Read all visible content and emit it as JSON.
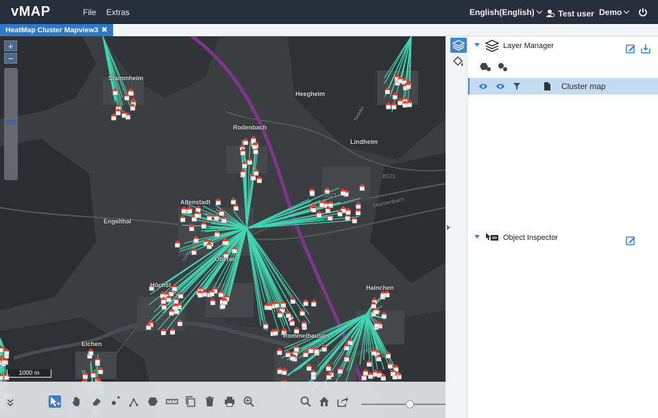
{
  "app": {
    "brand": "vMAP",
    "menu": [
      {
        "label": "File"
      },
      {
        "label": "Extras"
      }
    ],
    "language": "English(English)",
    "user": "Test user",
    "workspace": "Demo"
  },
  "tab": {
    "title": "HeatMap Cluster Mapview3",
    "close_glyph": "✖"
  },
  "map": {
    "zoom_in": "+",
    "zoom_out": "−",
    "scale": "1000 m",
    "places": [
      "Stammheim",
      "Heegheim",
      "Rodenbach",
      "Lindheim",
      "Altenstadt",
      "Engelthal",
      "Oberau",
      "Höchst",
      "Hainchen",
      "Rommelhausen",
      "Eichen"
    ],
    "roads": [
      "B521",
      "B521",
      "Seemenbach",
      "Nidder",
      "Nidder"
    ],
    "colors": {
      "cluster_line": "#3fd6b0",
      "highway": "#8a3b94",
      "house_roof": "#e0402d"
    }
  },
  "layer_manager": {
    "title": "Layer Manager",
    "layers": [
      {
        "name": "Cluster map",
        "visible": true
      }
    ]
  },
  "object_inspector": {
    "title": "Object Inspector"
  }
}
